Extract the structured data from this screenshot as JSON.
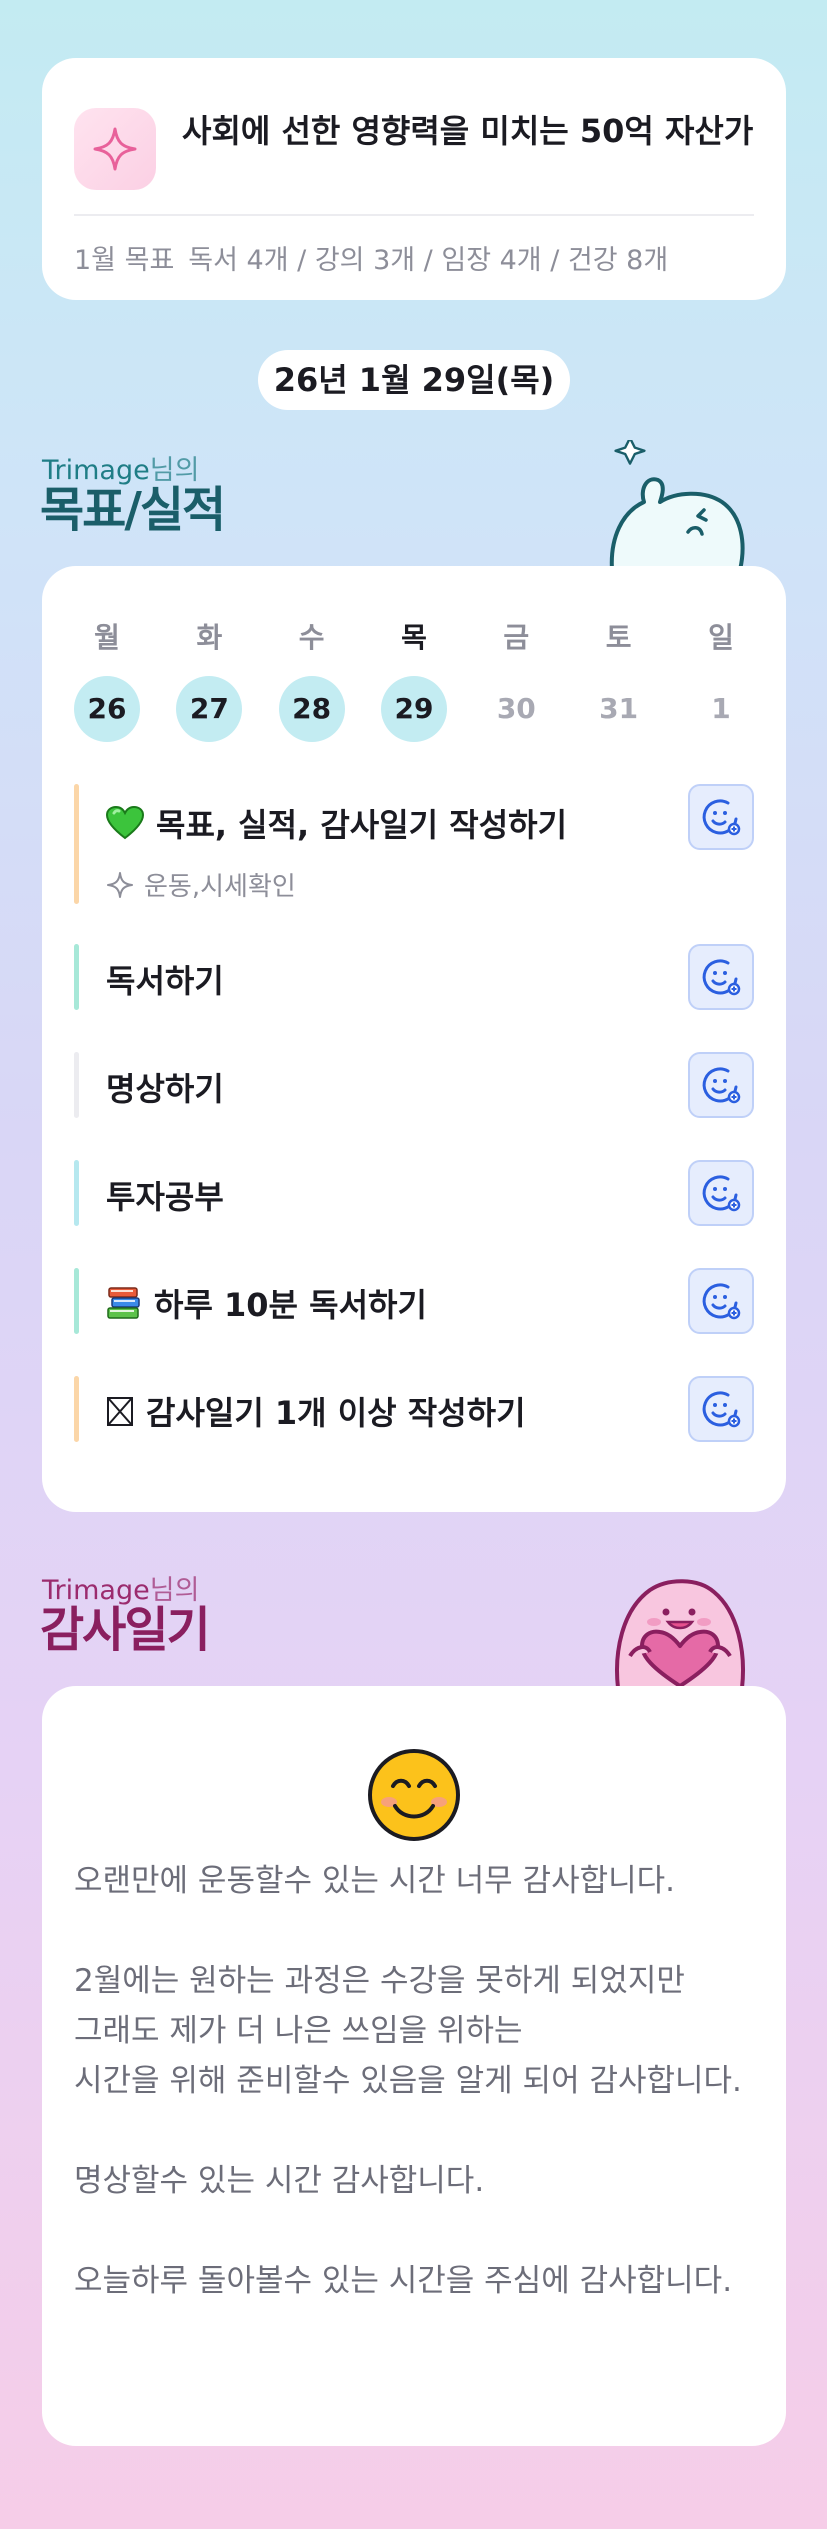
{
  "goal": {
    "title": "사회에 선한 영향력을 미치는 50억 자산가",
    "month_label": "1월 목표",
    "month_targets": "독서 4개 / 강의 3개 / 임장 4개 / 건강 8개"
  },
  "date": "26년 1월 29일(목)",
  "section1": {
    "owner": "Trimage",
    "owner_suffix": "님의",
    "title": "목표/실적"
  },
  "week": [
    {
      "name": "월",
      "date": "26",
      "state": "done"
    },
    {
      "name": "화",
      "date": "27",
      "state": "done"
    },
    {
      "name": "수",
      "date": "28",
      "state": "done"
    },
    {
      "name": "목",
      "date": "29",
      "state": "today"
    },
    {
      "name": "금",
      "date": "30",
      "state": "future"
    },
    {
      "name": "토",
      "date": "31",
      "state": "future"
    },
    {
      "name": "일",
      "date": "1",
      "state": "future"
    }
  ],
  "tasks": [
    {
      "label": "목표, 실적, 감사일기 작성하기",
      "icon": "green-heart-icon",
      "note": "운동,시세확인",
      "bar_color": "#fbd6a8"
    },
    {
      "label": "독서하기",
      "icon": "",
      "bar_color": "#a7e8d8"
    },
    {
      "label": "명상하기",
      "icon": "",
      "bar_color": "#ececf0"
    },
    {
      "label": "투자공부",
      "icon": "",
      "bar_color": "#b6e8ef"
    },
    {
      "label": "하루 10분 독서하기",
      "icon": "books-icon",
      "bar_color": "#a7e8d8"
    },
    {
      "label": "감사일기 1개 이상 작성하기",
      "icon": "ballot-box-x-icon",
      "bar_color": "#fbd6a8"
    }
  ],
  "section2": {
    "owner": "Trimage",
    "owner_suffix": "님의",
    "title": "감사일기"
  },
  "gratitude": {
    "emoji": "smiling-face-icon",
    "paragraphs": [
      "오랜만에 운동할수 있는 시간 너무 감사합니다.",
      "2월에는 원하는 과정은 수강을 못하게 되었지만\n그래도 제가 더 나은 쓰임을 위하는\n시간을 위해 준비할수 있음을 알게 되어 감사합니다.",
      "명상할수 있는 시간 감사합니다.",
      "오늘하루 돌아볼수 있는 시간을 주심에 감사합니다."
    ]
  },
  "colors": {
    "done_day": "#c3ecf2",
    "react_button_bg": "#e6edfd",
    "react_icon": "#2b5fe0",
    "section1_title": "#1a5e69",
    "section2_title": "#8a1f5f"
  }
}
